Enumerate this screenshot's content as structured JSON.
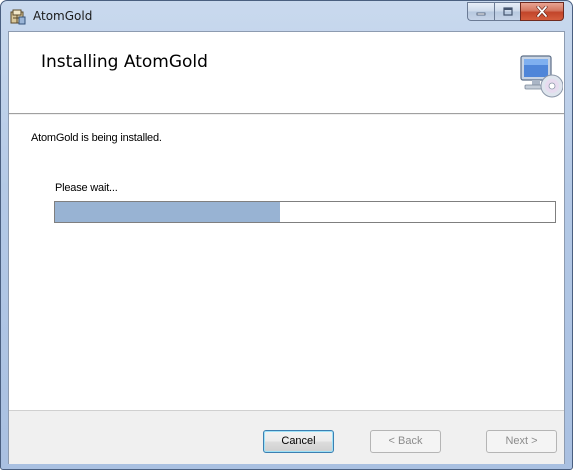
{
  "window": {
    "title": "AtomGold",
    "icon": "installer-package-icon",
    "caption_buttons": [
      "minimize-icon",
      "maximize-icon",
      "close-icon"
    ]
  },
  "banner": {
    "title": "Installing AtomGold",
    "icon": "computer-disc-icon"
  },
  "body": {
    "status": "AtomGold is being installed.",
    "wait_label": "Please wait...",
    "progress_fraction": 0.45
  },
  "footer": {
    "cancel_label": "Cancel",
    "back_label": "< Back",
    "next_label": "Next >"
  },
  "colors": {
    "progress_fill": "#98b3d3",
    "close_button": "#c2452a",
    "titlebar": "#b4c9e6"
  }
}
